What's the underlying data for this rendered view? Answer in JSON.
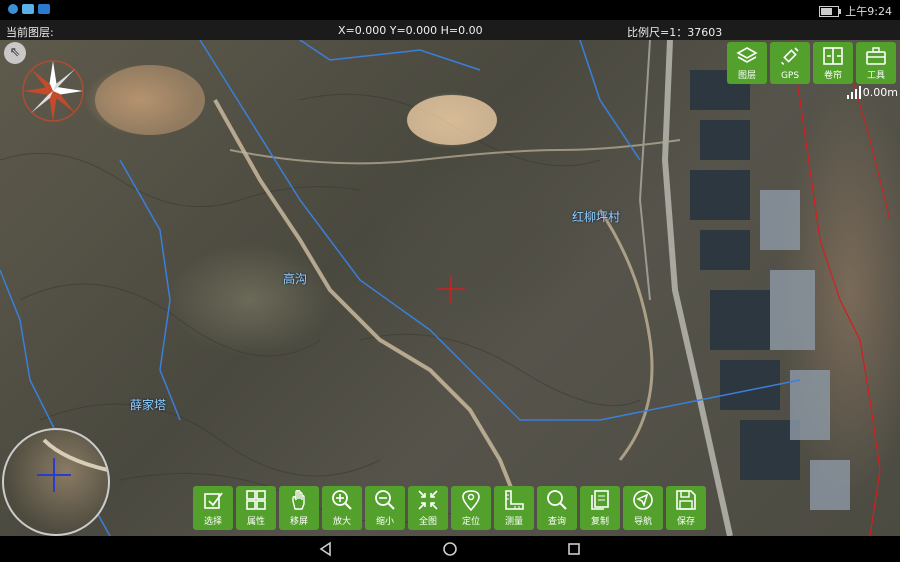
{
  "status_bar": {
    "time": "上午9:24",
    "icons": [
      "globe-icon",
      "cloud-icon",
      "message-icon",
      "battery-icon"
    ]
  },
  "info_bar": {
    "current_layer_label": "当前图层:",
    "coords": "X=0.000 Y=0.000 H=0.00",
    "scale": "比例尺=1：37603"
  },
  "map": {
    "labels": [
      "红柳坪村",
      "高沟",
      "薛家塔"
    ],
    "accent_color": "#53a02c",
    "route_color": "#3a7fd9",
    "boundary_color": "#d21f1f"
  },
  "top_toolbar": [
    {
      "label": "图层",
      "icon": "layers-icon"
    },
    {
      "label": "GPS",
      "icon": "gps-icon"
    },
    {
      "label": "卷帘",
      "icon": "swipe-icon"
    },
    {
      "label": "工具",
      "icon": "toolbox-icon"
    }
  ],
  "signal_text": "0.00m",
  "bottom_toolbar": [
    {
      "label": "选择",
      "icon": "select-icon"
    },
    {
      "label": "属性",
      "icon": "attribute-icon"
    },
    {
      "label": "移屏",
      "icon": "pan-icon"
    },
    {
      "label": "放大",
      "icon": "zoom-in-icon"
    },
    {
      "label": "缩小",
      "icon": "zoom-out-icon"
    },
    {
      "label": "全图",
      "icon": "full-extent-icon"
    },
    {
      "label": "定位",
      "icon": "locate-icon"
    },
    {
      "label": "测量",
      "icon": "measure-icon"
    },
    {
      "label": "查询",
      "icon": "search-icon"
    },
    {
      "label": "复制",
      "icon": "copy-icon"
    },
    {
      "label": "导航",
      "icon": "navigate-icon"
    },
    {
      "label": "保存",
      "icon": "save-icon"
    }
  ]
}
